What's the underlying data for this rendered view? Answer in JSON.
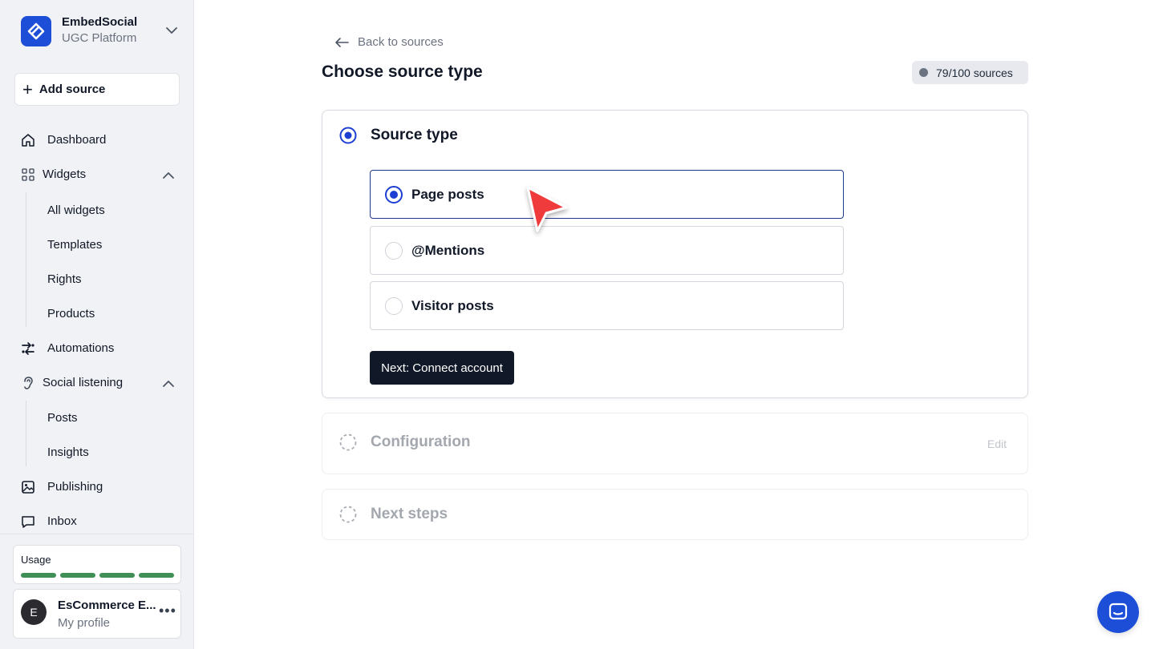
{
  "brand": {
    "name": "EmbedSocial",
    "subtitle": "UGC Platform"
  },
  "sidebar": {
    "add_source": "Add source",
    "dashboard": "Dashboard",
    "widgets": {
      "label": "Widgets",
      "children": [
        "All widgets",
        "Templates",
        "Rights",
        "Products"
      ]
    },
    "automations": "Automations",
    "social_listening": {
      "label": "Social listening",
      "children": [
        "Posts",
        "Insights"
      ]
    },
    "publishing": "Publishing",
    "inbox": "Inbox",
    "usage": {
      "label": "Usage",
      "segments": 4,
      "color": "#3f8f57"
    },
    "profile": {
      "initial": "E",
      "name": "EsCommerce E...",
      "subtitle": "My profile",
      "more": "•••"
    }
  },
  "main": {
    "back_link": "Back to sources",
    "title": "Choose source type",
    "quota": "79/100 sources",
    "step1": {
      "title": "Source type",
      "options": [
        "Page posts",
        "@Mentions",
        "Visitor posts"
      ],
      "selected_index": 0,
      "next_button": "Next: Connect account"
    },
    "step2": {
      "title": "Configuration",
      "edit": "Edit"
    },
    "step3": {
      "title": "Next steps"
    }
  },
  "colors": {
    "accent": "#1d4ed8",
    "dark_button": "#111827",
    "cursor": "#ef3b3b"
  }
}
